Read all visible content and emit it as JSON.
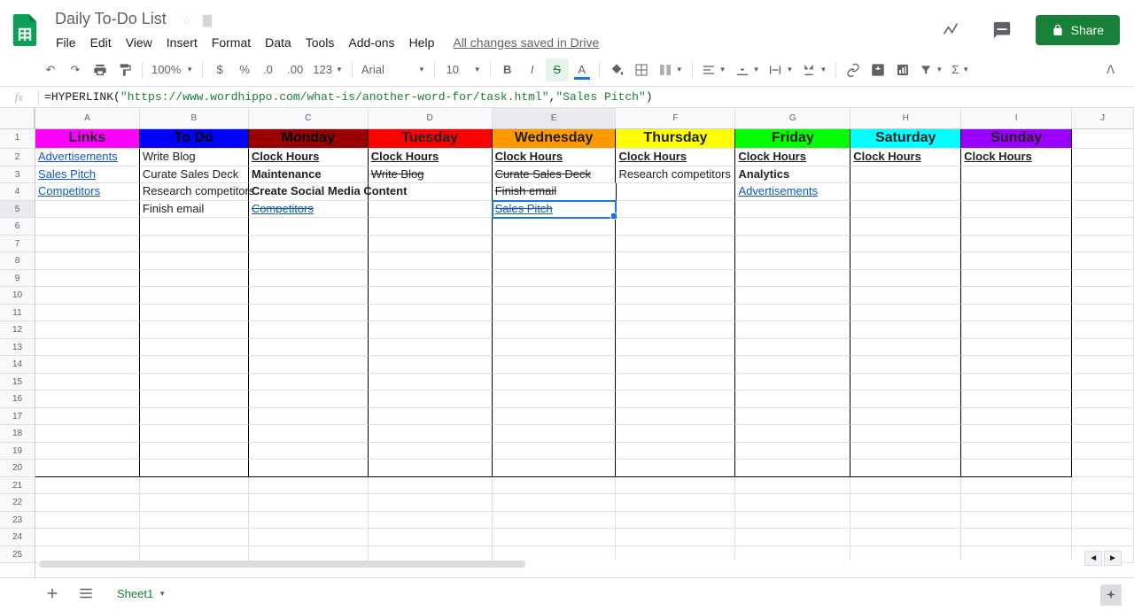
{
  "doc": {
    "title": "Daily To-Do List"
  },
  "menus": [
    "File",
    "Edit",
    "View",
    "Insert",
    "Format",
    "Data",
    "Tools",
    "Add-ons",
    "Help"
  ],
  "saved_msg": "All changes saved in Drive",
  "share_label": "Share",
  "toolbar": {
    "zoom": "100%",
    "font": "Arial",
    "font_size": "10"
  },
  "formula": {
    "prefix": "=",
    "fn": "HYPERLINK",
    "arg1": "\"https://www.wordhippo.com/what-is/another-word-for/task.html\"",
    "arg2": "\"Sales Pitch\""
  },
  "columns": [
    "A",
    "B",
    "C",
    "D",
    "E",
    "F",
    "G",
    "H",
    "I",
    "J"
  ],
  "selected_col": "E",
  "row_count": 25,
  "selected_row": 5,
  "headers": {
    "A": "Links",
    "B": "To Do",
    "C": "Monday",
    "D": "Tuesday",
    "E": "Wednesday",
    "F": "Thursday",
    "G": "Friday",
    "H": "Saturday",
    "I": "Sunday"
  },
  "cells": {
    "r2": {
      "A": {
        "t": "Advertisements",
        "link": true
      },
      "B": {
        "t": "Write Blog"
      },
      "C": {
        "t": "Clock Hours",
        "bold": true,
        "ul": true
      },
      "D": {
        "t": "Clock Hours",
        "bold": true,
        "ul": true
      },
      "E": {
        "t": "Clock Hours",
        "bold": true,
        "ul": true
      },
      "F": {
        "t": "Clock Hours",
        "bold": true,
        "ul": true
      },
      "G": {
        "t": "Clock Hours",
        "bold": true,
        "ul": true
      },
      "H": {
        "t": "Clock Hours",
        "bold": true,
        "ul": true
      },
      "I": {
        "t": "Clock Hours",
        "bold": true,
        "ul": true
      }
    },
    "r3": {
      "A": {
        "t": "Sales Pitch",
        "link": true
      },
      "B": {
        "t": "Curate Sales Deck"
      },
      "C": {
        "t": "Maintenance",
        "bold": true
      },
      "D": {
        "t": "Write Blog",
        "strike": true
      },
      "E": {
        "t": "Curate Sales Deck",
        "strike": true
      },
      "F": {
        "t": "Research competitors"
      },
      "G": {
        "t": "Analytics",
        "bold": true
      }
    },
    "r4": {
      "A": {
        "t": "Competitors",
        "link": true
      },
      "B": {
        "t": "Research competitors"
      },
      "C": {
        "t": "Create Social Media Content",
        "bold": true
      },
      "E": {
        "t": "Finish email",
        "strike": true
      },
      "G": {
        "t": "Advertisements",
        "link": true
      }
    },
    "r5": {
      "B": {
        "t": "Finish email"
      },
      "C": {
        "t": "Competitors",
        "link": true,
        "strike": true
      },
      "E": {
        "t": "Sales Pitch",
        "link": true,
        "strike": true,
        "selected": true
      }
    }
  },
  "sheet_tab": "Sheet1"
}
